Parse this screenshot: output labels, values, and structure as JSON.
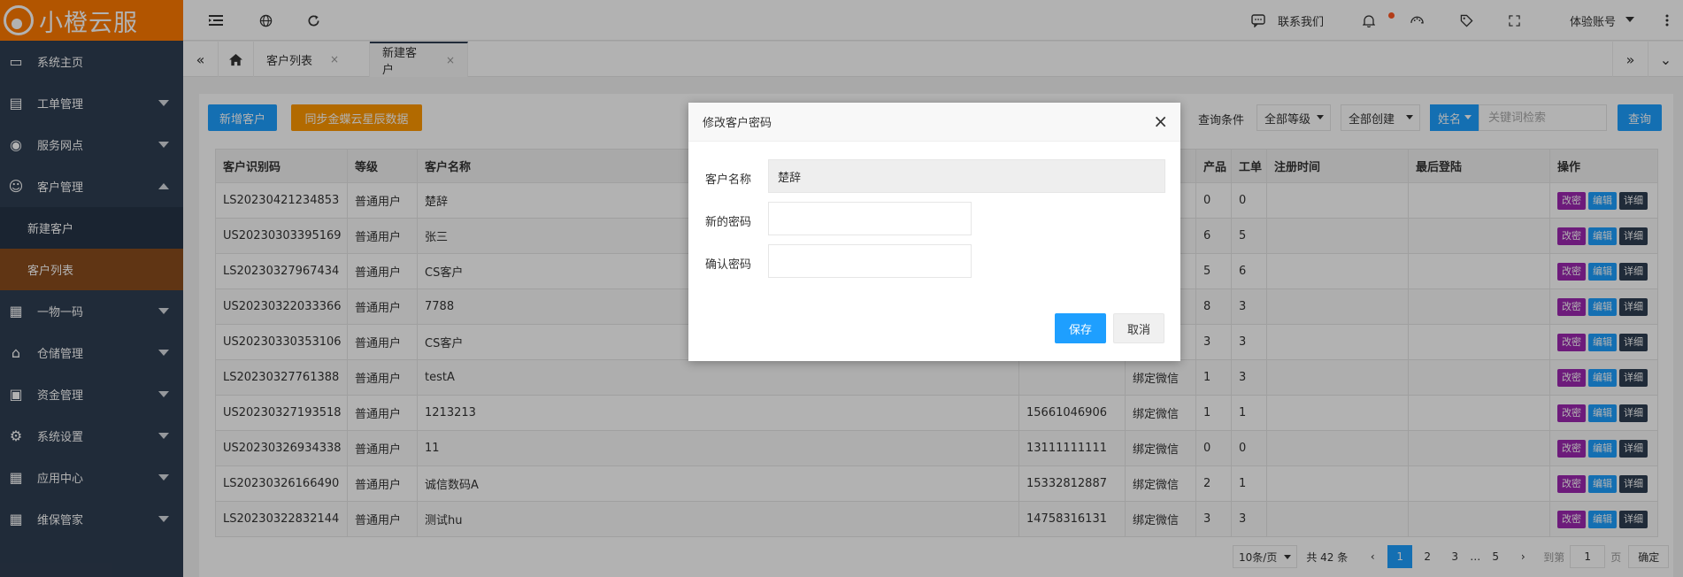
{
  "brand": {
    "name": "小橙云服"
  },
  "sidebar": {
    "items": [
      {
        "label": "系统主页",
        "icon": "monitor-icon",
        "glyph": "▭"
      },
      {
        "label": "工单管理",
        "icon": "document-icon",
        "glyph": "▤"
      },
      {
        "label": "服务网点",
        "icon": "globe-icon",
        "glyph": "◉"
      },
      {
        "label": "客户管理",
        "icon": "user-icon",
        "glyph": "☺"
      },
      {
        "label": "一物一码",
        "icon": "grid-icon",
        "glyph": "▦"
      },
      {
        "label": "仓储管理",
        "icon": "bank-icon",
        "glyph": "⌂"
      },
      {
        "label": "资金管理",
        "icon": "money-icon",
        "glyph": "▣"
      },
      {
        "label": "系统设置",
        "icon": "gear-icon",
        "glyph": "⚙"
      },
      {
        "label": "应用中心",
        "icon": "apps-icon",
        "glyph": "▦"
      },
      {
        "label": "维保管家",
        "icon": "apps-icon",
        "glyph": "▦"
      }
    ],
    "sub_items": [
      {
        "label": "新建客户"
      },
      {
        "label": "客户列表"
      }
    ]
  },
  "topbar": {
    "contact": "联系我们",
    "account": "体验账号"
  },
  "tabs": {
    "items": [
      {
        "label": "客户列表"
      },
      {
        "label": "新建客户"
      }
    ],
    "close_glyph": "×"
  },
  "toolbar": {
    "new_customer": "新增客户",
    "sync": "同步金蝶云星辰数据",
    "query_label": "查询条件",
    "level_select": "全部等级",
    "create_select": "全部创建",
    "field_select": "姓名",
    "search_placeholder": "关键词检索",
    "search_button": "查询"
  },
  "table": {
    "columns": [
      "客户识别码",
      "等级",
      "客户名称",
      "",
      "",
      "产品",
      "工单",
      "注册时间",
      "最后登陆",
      "操作"
    ],
    "rows": [
      {
        "code": "LS20230421234853",
        "level": "普通用户",
        "name": "楚辞",
        "phone": "",
        "wechat": "",
        "products": "0",
        "orders": "0"
      },
      {
        "code": "US20230303395169",
        "level": "普通用户",
        "name": "张三",
        "phone": "",
        "wechat": "",
        "products": "6",
        "orders": "5"
      },
      {
        "code": "LS20230327967434",
        "level": "普通用户",
        "name": "CS客户",
        "phone": "",
        "wechat": "",
        "products": "5",
        "orders": "6"
      },
      {
        "code": "US20230322033366",
        "level": "普通用户",
        "name": "7788",
        "phone": "",
        "wechat": "",
        "products": "8",
        "orders": "3"
      },
      {
        "code": "US20230330353106",
        "level": "普通用户",
        "name": "CS客户",
        "phone": "",
        "wechat": "",
        "products": "3",
        "orders": "3"
      },
      {
        "code": "LS20230327761388",
        "level": "普通用户",
        "name": "testA",
        "phone": "",
        "wechat": "绑定微信",
        "products": "1",
        "orders": "3"
      },
      {
        "code": "US20230327193518",
        "level": "普通用户",
        "name": "1213213",
        "phone": "15661046906",
        "wechat": "绑定微信",
        "products": "1",
        "orders": "1"
      },
      {
        "code": "US20230326934338",
        "level": "普通用户",
        "name": "11",
        "phone": "13111111111",
        "wechat": "绑定微信",
        "products": "0",
        "orders": "0"
      },
      {
        "code": "LS20230326166490",
        "level": "普通用户",
        "name": "诚信数码A",
        "phone": "15332812887",
        "wechat": "绑定微信",
        "products": "2",
        "orders": "1"
      },
      {
        "code": "LS20230322832144",
        "level": "普通用户",
        "name": "测试hu",
        "phone": "14758316131",
        "wechat": "绑定微信",
        "products": "3",
        "orders": "3"
      }
    ],
    "ops": {
      "reset_password": "改密",
      "edit": "编辑",
      "detail": "详细"
    }
  },
  "pager": {
    "page_size": "10条/页",
    "total": "共 42 条",
    "pages": [
      "1",
      "2",
      "3",
      "…",
      "5"
    ],
    "goto_label": "到第",
    "goto_value": "1",
    "page_unit": "页",
    "confirm": "确定"
  },
  "modal": {
    "title": "修改客户密码",
    "name_label": "客户名称",
    "name_value": "楚辞",
    "new_password_label": "新的密码",
    "confirm_password_label": "确认密码",
    "save": "保存",
    "cancel": "取消"
  },
  "colors": {
    "brand_orange": "#ff7a00",
    "sidebar_bg": "#2f3e52",
    "accent_blue": "#1e9fff",
    "op_purple": "#9c27b0",
    "active_sub": "#8a4d1e"
  }
}
